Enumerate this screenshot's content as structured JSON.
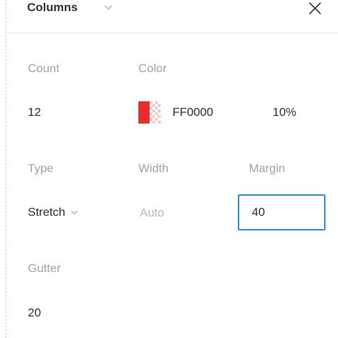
{
  "header": {
    "title": "Columns"
  },
  "labels": {
    "count": "Count",
    "color": "Color",
    "type": "Type",
    "width": "Width",
    "margin": "Margin",
    "gutter": "Gutter"
  },
  "values": {
    "count": "12",
    "color_hex": "FF0000",
    "opacity": "10%",
    "type": "Stretch",
    "width": "Auto",
    "margin": "40",
    "gutter": "20"
  },
  "colors": {
    "swatch": "#ee2a2a",
    "focus_border": "#1e8ee6"
  },
  "icons": {
    "close": "close-icon",
    "chevron": "chevron-down-icon"
  }
}
